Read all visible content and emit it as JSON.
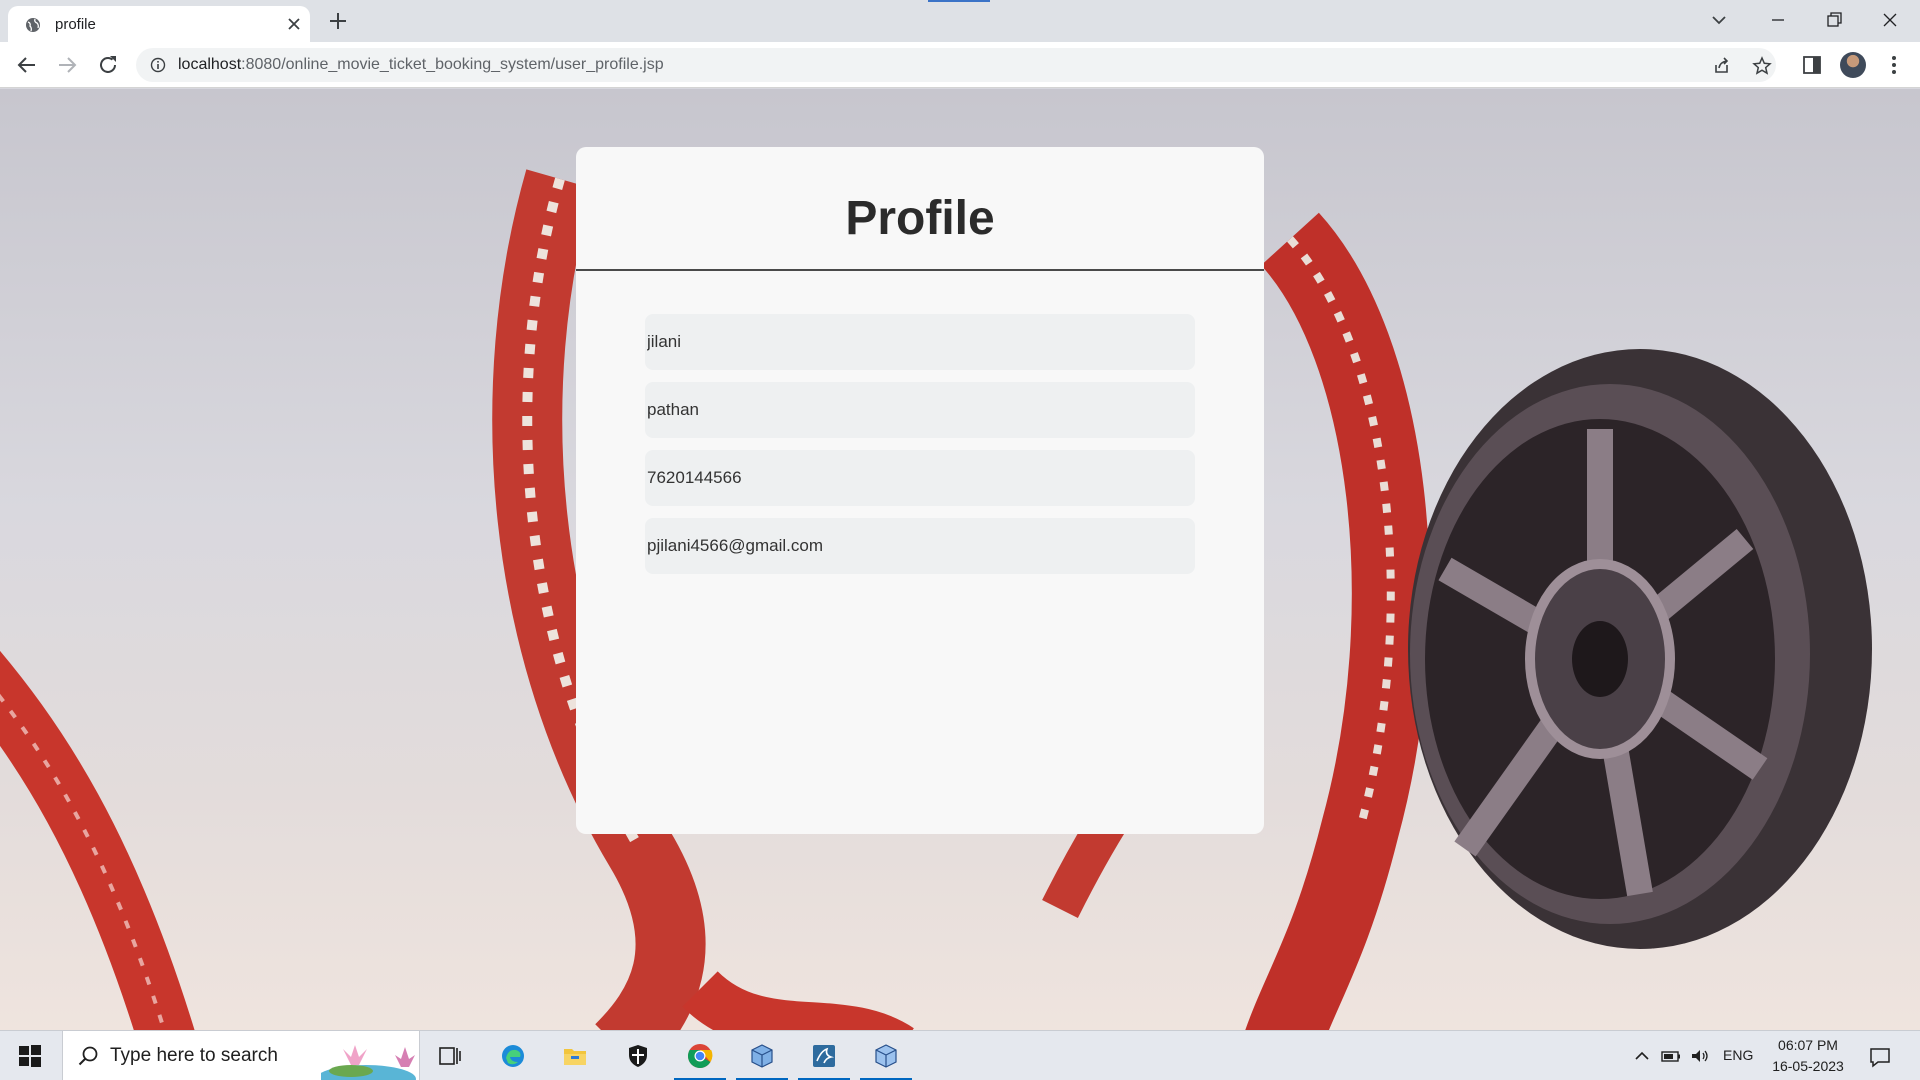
{
  "browser": {
    "tab_title": "profile",
    "url_host": "localhost",
    "url_path": ":8080/online_movie_ticket_booking_system/user_profile.jsp"
  },
  "page": {
    "title": "Profile",
    "fields": [
      {
        "value": "jilani"
      },
      {
        "value": "pathan"
      },
      {
        "value": "7620144566"
      },
      {
        "value": "pjilani4566@gmail.com"
      }
    ]
  },
  "taskbar": {
    "search_placeholder": "Type here to search",
    "language": "ENG",
    "time": "06:07 PM",
    "date": "16-05-2023"
  },
  "icons": [
    "globe-icon",
    "close-icon",
    "plus-icon",
    "chevron-down-icon",
    "minimize-icon",
    "restore-icon",
    "back-icon",
    "forward-icon",
    "reload-icon",
    "info-icon",
    "share-icon",
    "star-icon",
    "sidepanel-icon",
    "more-icon",
    "windows-start-icon",
    "search-icon",
    "task-view-icon",
    "edge-icon",
    "file-explorer-icon",
    "shield-icon",
    "chrome-icon",
    "cube-icon",
    "mysql-workbench-icon",
    "chevron-up-icon",
    "battery-icon",
    "volume-icon",
    "notification-icon"
  ]
}
